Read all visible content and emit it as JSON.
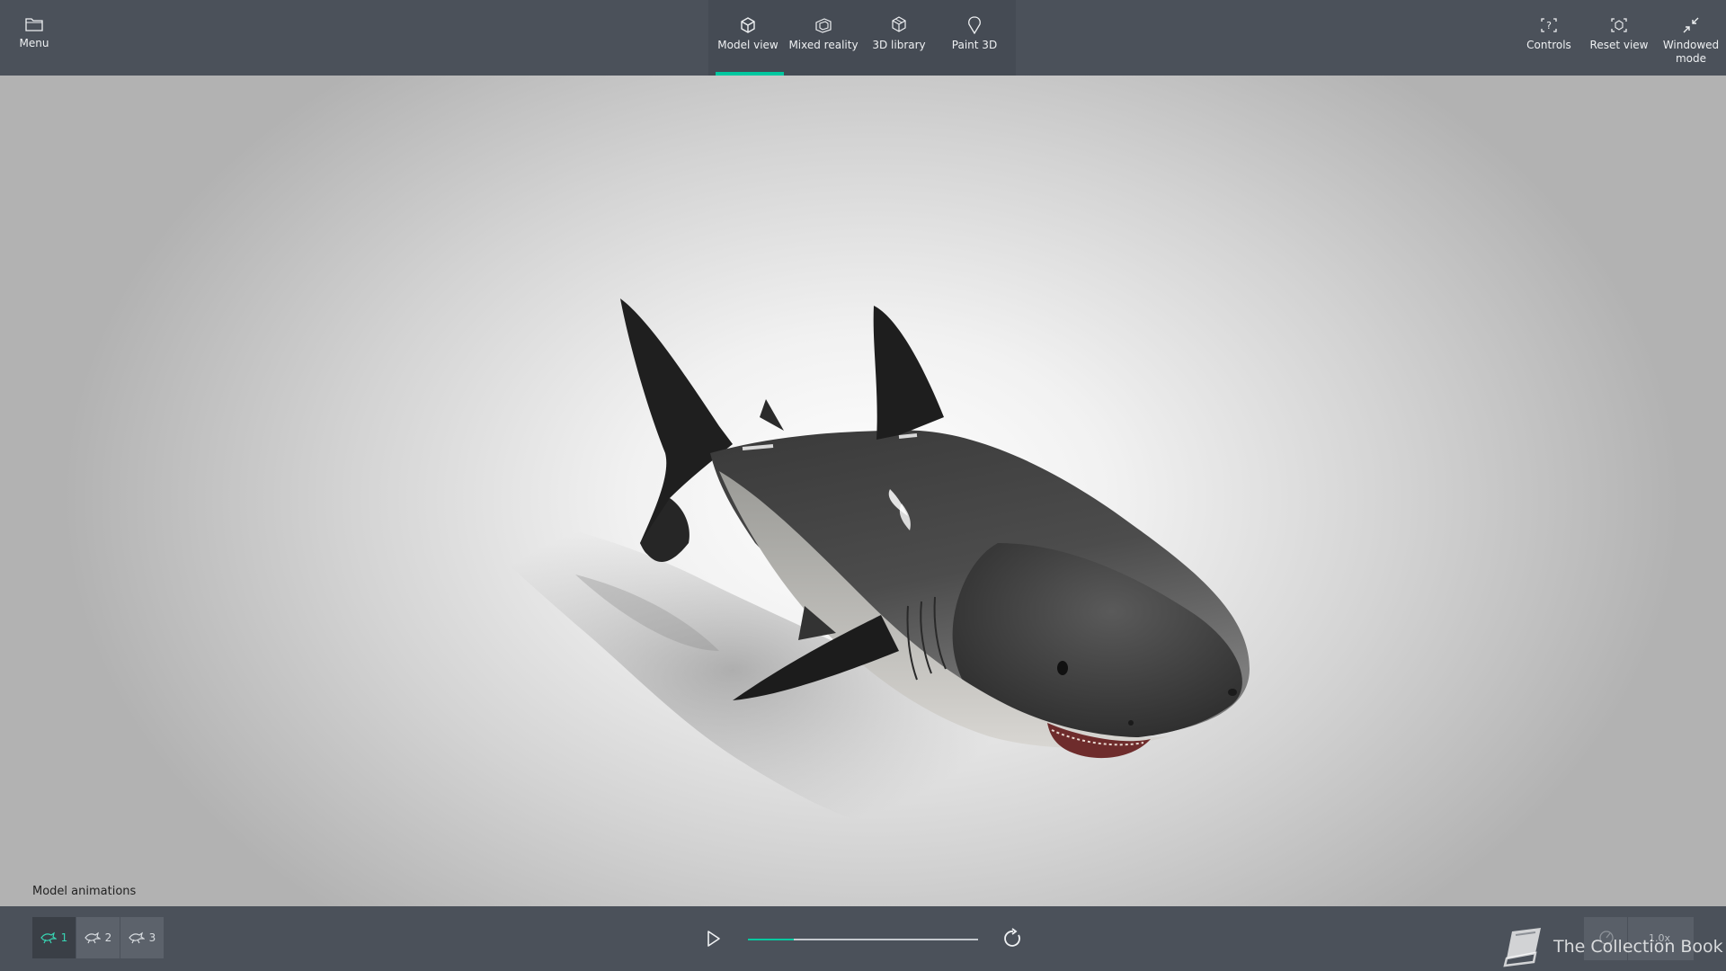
{
  "topbar": {
    "menu_label": "Menu",
    "tabs": [
      {
        "label": "Model view",
        "active": true
      },
      {
        "label": "Mixed reality",
        "active": false
      },
      {
        "label": "3D library",
        "active": false
      },
      {
        "label": "Paint 3D",
        "active": false
      }
    ],
    "right": [
      {
        "label": "Controls"
      },
      {
        "label": "Reset view"
      },
      {
        "label": "Windowed mode"
      }
    ]
  },
  "viewport": {
    "model": "shark-3d-model",
    "section_title": "Model animations"
  },
  "animations": {
    "items": [
      {
        "label": "1",
        "active": true
      },
      {
        "label": "2",
        "active": false
      },
      {
        "label": "3",
        "active": false
      }
    ],
    "progress": 0.2,
    "speed": "1.0x"
  },
  "watermark": "The Collection Book",
  "colors": {
    "bar": "#4b515a",
    "accent": "#00c8a0",
    "active_anim_icon": "#38d6b4"
  }
}
